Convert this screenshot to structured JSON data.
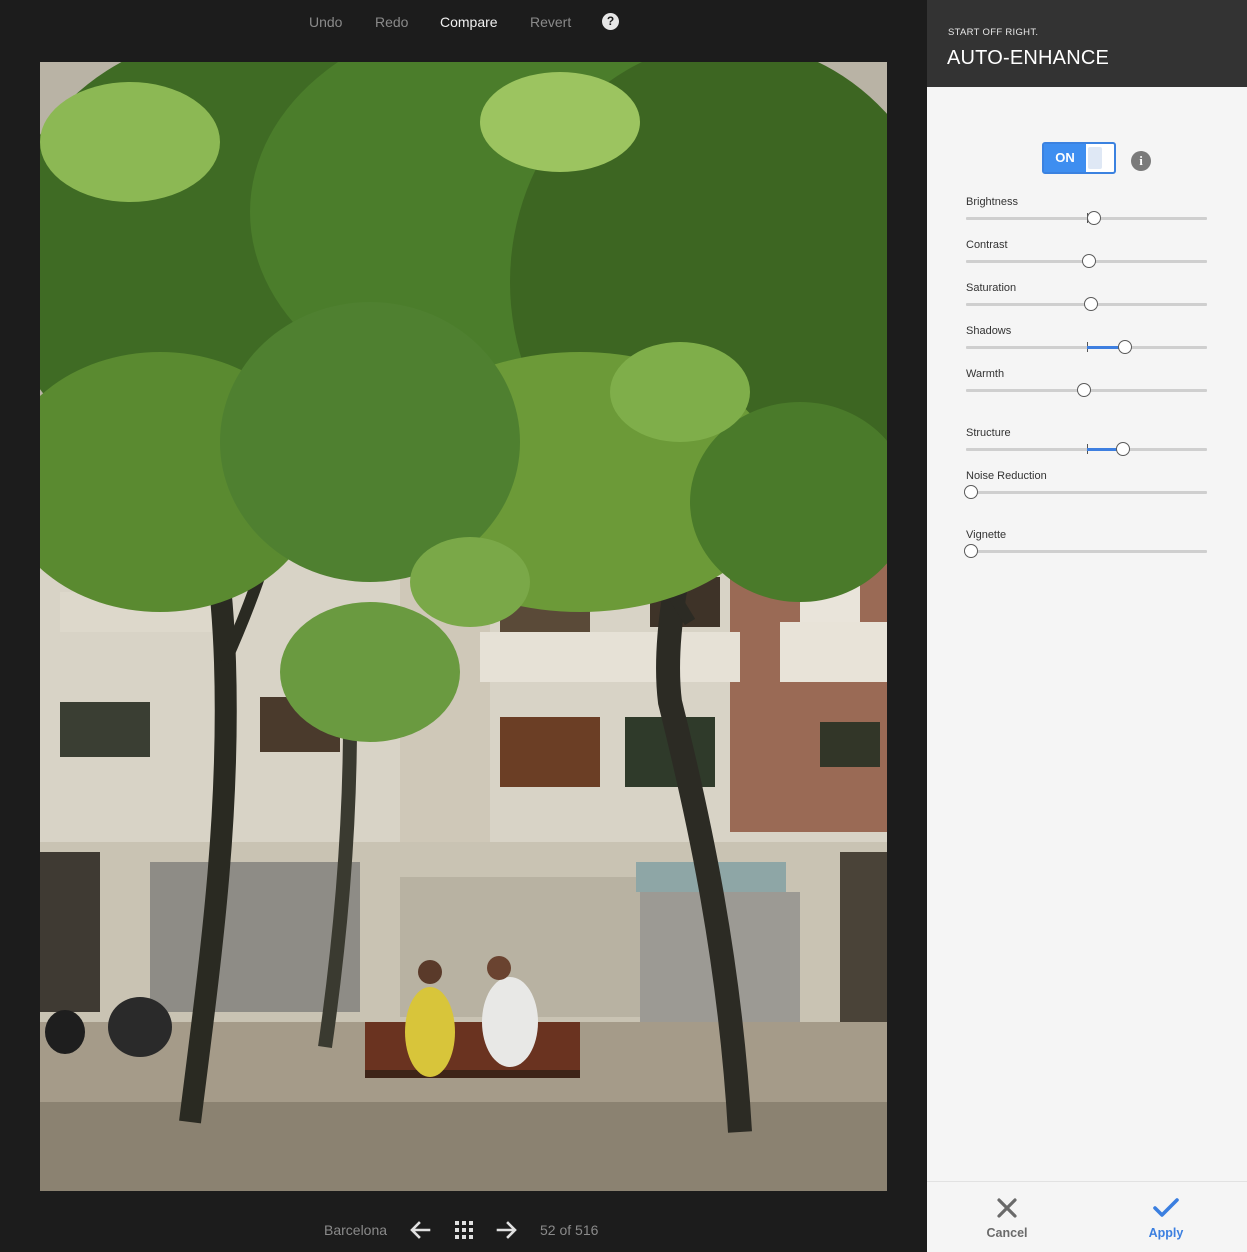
{
  "toolbar": {
    "undo": "Undo",
    "redo": "Redo",
    "compare": "Compare",
    "revert": "Revert",
    "help": "?"
  },
  "bottom_bar": {
    "album": "Barcelona",
    "counter": "52 of 516"
  },
  "panel": {
    "subtitle": "START OFF RIGHT.",
    "title": "AUTO-ENHANCE",
    "toggle_label": "ON",
    "info": "i",
    "sliders": [
      {
        "label": "Brightness",
        "value": 0.53,
        "center": 0.5
      },
      {
        "label": "Contrast",
        "value": 0.51,
        "center": 0.5
      },
      {
        "label": "Saturation",
        "value": 0.52,
        "center": 0.5
      },
      {
        "label": "Shadows",
        "value": 0.66,
        "center": 0.5
      },
      {
        "label": "Warmth",
        "value": 0.49,
        "center": 0.5
      },
      {
        "label": "Structure",
        "value": 0.65,
        "center": 0.5
      },
      {
        "label": "Noise Reduction",
        "value": 0.02,
        "center": null
      },
      {
        "label": "Vignette",
        "value": 0.02,
        "center": null
      }
    ],
    "cancel": "Cancel",
    "apply": "Apply"
  },
  "colors": {
    "accent": "#3e8ef0",
    "header_bg": "#333333",
    "viewer_bg": "#1c1c1c",
    "panel_bg": "#f5f5f5"
  }
}
